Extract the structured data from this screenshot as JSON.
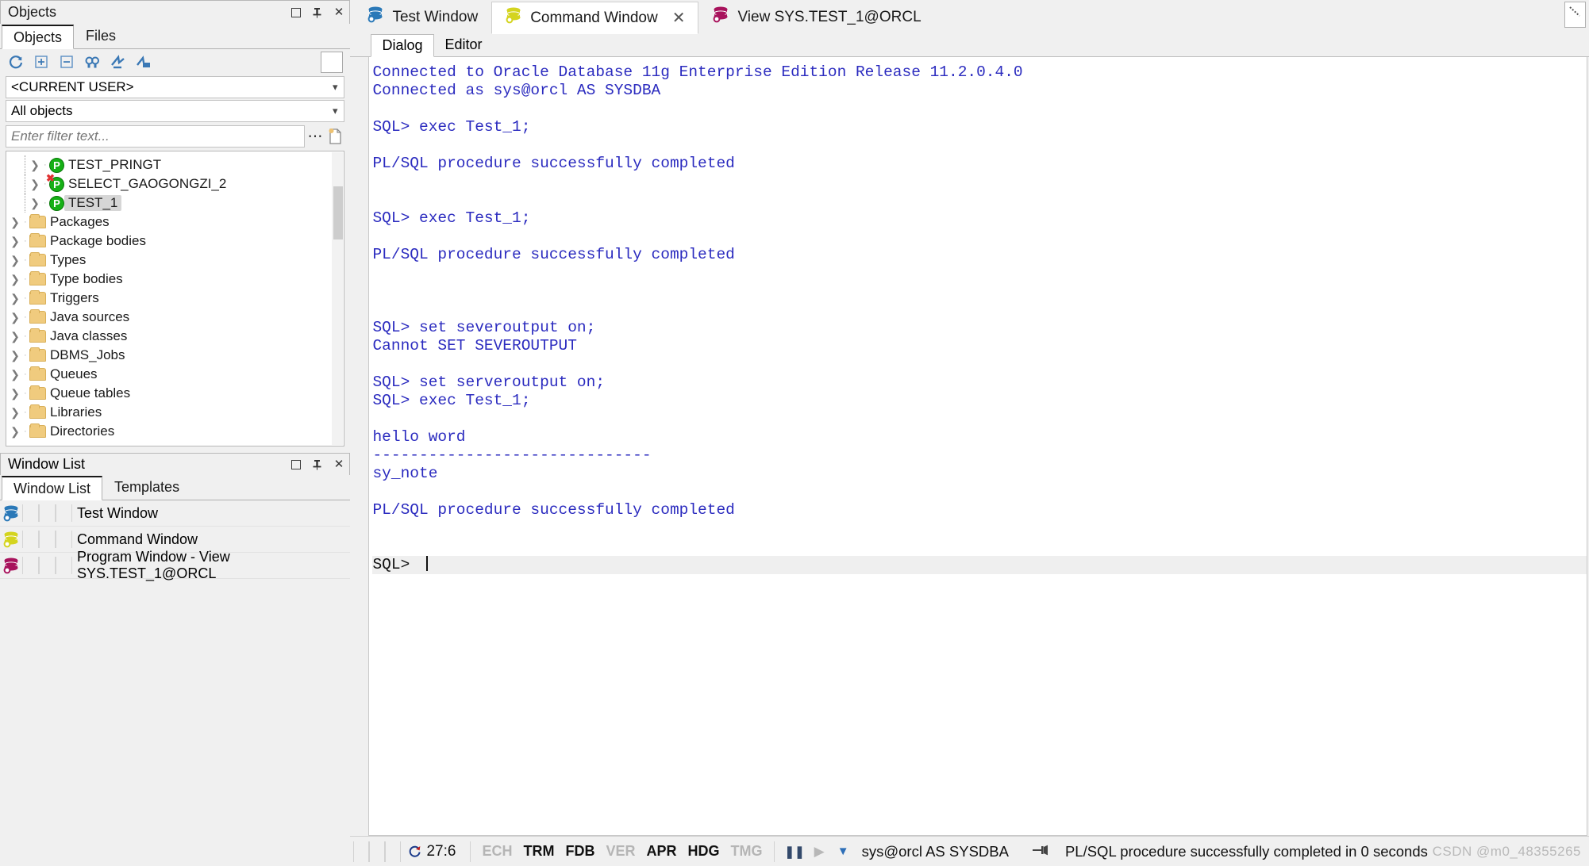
{
  "objects_panel": {
    "caption": "Objects",
    "caption_buttons": [
      "maximize-icon",
      "pin-icon",
      "close-icon"
    ],
    "tabs": [
      {
        "label": "Objects",
        "active": true
      },
      {
        "label": "Files",
        "active": false
      }
    ],
    "toolbar_icons": [
      "refresh-icon",
      "expand-all-icon",
      "collapse-all-icon",
      "find-icon",
      "goto-icon",
      "open-folder-icon"
    ],
    "user_select": {
      "value": "<CURRENT USER>"
    },
    "object_select": {
      "value": "All objects"
    },
    "filter": {
      "placeholder": "Enter filter text...",
      "value": ""
    },
    "tree": [
      {
        "label": "TEST_PRINGT",
        "icon": "procedure-icon",
        "indent": 1,
        "selected": false,
        "invalid": false
      },
      {
        "label": "SELECT_GAOGONGZI_2",
        "icon": "procedure-icon",
        "indent": 1,
        "selected": false,
        "invalid": true
      },
      {
        "label": "TEST_1",
        "icon": "procedure-icon",
        "indent": 1,
        "selected": true,
        "invalid": false
      },
      {
        "label": "Packages",
        "icon": "folder-icon",
        "indent": 0,
        "selected": false,
        "invalid": false
      },
      {
        "label": "Package bodies",
        "icon": "folder-icon",
        "indent": 0,
        "selected": false,
        "invalid": false
      },
      {
        "label": "Types",
        "icon": "folder-icon",
        "indent": 0,
        "selected": false,
        "invalid": false
      },
      {
        "label": "Type bodies",
        "icon": "folder-icon",
        "indent": 0,
        "selected": false,
        "invalid": false
      },
      {
        "label": "Triggers",
        "icon": "folder-icon",
        "indent": 0,
        "selected": false,
        "invalid": false
      },
      {
        "label": "Java sources",
        "icon": "folder-icon",
        "indent": 0,
        "selected": false,
        "invalid": false
      },
      {
        "label": "Java classes",
        "icon": "folder-icon",
        "indent": 0,
        "selected": false,
        "invalid": false
      },
      {
        "label": "DBMS_Jobs",
        "icon": "folder-icon",
        "indent": 0,
        "selected": false,
        "invalid": false
      },
      {
        "label": "Queues",
        "icon": "folder-icon",
        "indent": 0,
        "selected": false,
        "invalid": false
      },
      {
        "label": "Queue tables",
        "icon": "folder-icon",
        "indent": 0,
        "selected": false,
        "invalid": false
      },
      {
        "label": "Libraries",
        "icon": "folder-icon",
        "indent": 0,
        "selected": false,
        "invalid": false
      },
      {
        "label": "Directories",
        "icon": "folder-icon",
        "indent": 0,
        "selected": false,
        "invalid": false
      }
    ]
  },
  "window_list_panel": {
    "caption": "Window List",
    "caption_buttons": [
      "maximize-icon",
      "pin-icon",
      "close-icon"
    ],
    "tabs": [
      {
        "label": "Window List",
        "active": true
      },
      {
        "label": "Templates",
        "active": false
      }
    ],
    "items": [
      {
        "label": "Test Window",
        "icon_color": "#2b79b8"
      },
      {
        "label": "Command Window",
        "icon_color": "#d4d41f"
      },
      {
        "label": "Program Window - View SYS.TEST_1@ORCL",
        "icon_color": "#a8135c"
      }
    ]
  },
  "main": {
    "tabs": [
      {
        "label": "Test Window",
        "icon_color": "#2b79b8",
        "active": false,
        "closable": false
      },
      {
        "label": "Command Window",
        "icon_color": "#d4d41f",
        "active": true,
        "closable": true
      },
      {
        "label": "View SYS.TEST_1@ORCL",
        "icon_color": "#a8135c",
        "active": false,
        "closable": false
      }
    ],
    "sub_tabs": [
      {
        "label": "Dialog",
        "active": true
      },
      {
        "label": "Editor",
        "active": false
      }
    ],
    "console_lines": [
      "Connected to Oracle Database 11g Enterprise Edition Release 11.2.0.4.0",
      "Connected as sys@orcl AS SYSDBA",
      "",
      "SQL> exec Test_1;",
      "",
      "PL/SQL procedure successfully completed",
      "",
      "",
      "SQL> exec Test_1;",
      "",
      "PL/SQL procedure successfully completed",
      "",
      "",
      "",
      "SQL> set severoutput on;",
      "Cannot SET SEVEROUTPUT",
      "",
      "SQL> set serveroutput on;",
      "SQL> exec Test_1;",
      "",
      "hello word",
      "------------------------------",
      "sy_note",
      "",
      "PL/SQL procedure successfully completed",
      "",
      ""
    ],
    "console_prompt": "SQL> "
  },
  "statusbar": {
    "cursor_position": "27:6",
    "flags": [
      {
        "label": "ECH",
        "on": false
      },
      {
        "label": "TRM",
        "on": true
      },
      {
        "label": "FDB",
        "on": true
      },
      {
        "label": "VER",
        "on": false
      },
      {
        "label": "APR",
        "on": true
      },
      {
        "label": "HDG",
        "on": true
      },
      {
        "label": "TMG",
        "on": false
      }
    ],
    "pause_icon": "pause-icon",
    "play_icon": "play-icon",
    "dropdown_icon": "chevron-down-icon",
    "connection": "sys@orcl AS SYSDBA",
    "pin_icon": "pin-message-icon",
    "message": "PL/SQL procedure successfully completed in 0 seconds",
    "watermark": "CSDN @m0_48355265"
  }
}
